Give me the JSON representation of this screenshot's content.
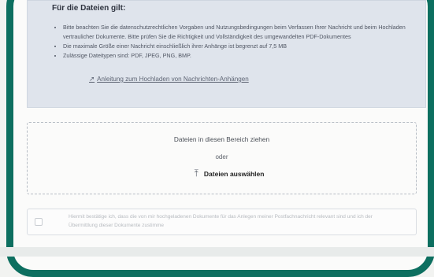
{
  "info": {
    "heading": "Für die Dateien gilt:",
    "bullets": [
      "Bitte beachten Sie die datenschutzrechtlichen Vorgaben und Nutzungsbedingungen beim Verfassen Ihrer Nachricht und beim Hochladen vertraulicher Dokumente. Bitte prüfen Sie die Richtigkeit und Vollständigkeit des umgewandelten PDF-Dokumentes",
      "Die maximale Größe einer Nachricht einschließlich ihrer Anhänge ist begrenzt auf 7,5 MB",
      "Zulässige Dateitypen sind: PDF, JPEG, PNG, BMP."
    ],
    "link_icon": "external-link-icon",
    "link_label": "Anleitung zum Hochladen von Nachrichten-Anhängen"
  },
  "dropzone": {
    "text": "Dateien in diesen Bereich ziehen",
    "or": "oder",
    "select_button_label": "Dateien auswählen",
    "upload_icon": "upload-icon"
  },
  "confirmation": {
    "text": "Hiermit bestätige ich, dass die von mir hochgeladenen Dokumente für das Anlegen meiner Postfachnachricht relevant sind und ich der Übermittlung dieser Dokumente zustimme"
  },
  "colors": {
    "frame": "#0d6f60",
    "info_background": "#dfe4ec",
    "page_background": "#fbfbfa"
  }
}
